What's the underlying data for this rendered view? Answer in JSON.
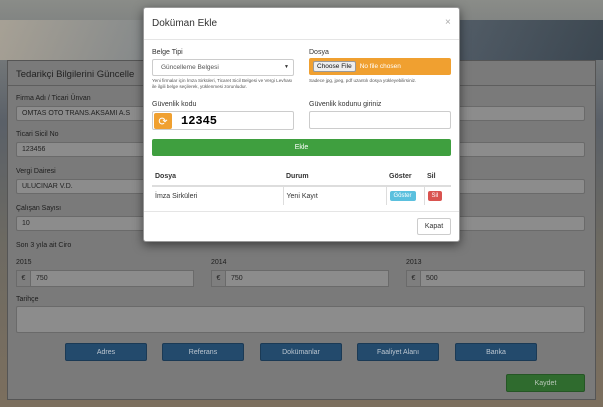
{
  "page": {
    "title": "Tedarikçi Bilgilerini Güncelle",
    "fields": {
      "company_label": "Firma Adı / Ticari Ünvan",
      "company_value": "OMTAS OTO TRANS.AKSAMI A.S",
      "trade_reg_label": "Ticari Sicil No",
      "trade_reg_value": "123456",
      "tax_office_label": "Vergi Dairesi",
      "tax_office_value": "ULUCINAR V.D.",
      "employees_label": "Çalışan Sayısı",
      "employees_value": "10",
      "revenue_label": "Son 3 yıla ait Ciro",
      "year1": "2015",
      "year1_value": "750",
      "year2": "2014",
      "year2_value": "750",
      "year3": "2013",
      "year3_value": "500",
      "currency_symbol": "€",
      "history_label": "Tarihçe"
    },
    "tabs": [
      "Adres",
      "Referans",
      "Dokümanlar",
      "Faaliyet Alanı",
      "Banka"
    ],
    "save_label": "Kaydet"
  },
  "modal": {
    "title": "Doküman Ekle",
    "close_glyph": "×",
    "doc_type_label": "Belge Tipi",
    "doc_type_value": "Güncelleme Belgesi",
    "doc_type_help": "Yeni firmalar için İmza Sirküleri, Ticaret Sicil Belgesi ve Vergi Levhası ile ilgili belge seçilerek, yüklenmesi zorunludur.",
    "file_label": "Dosya",
    "file_button": "Choose File",
    "file_status": "No file chosen",
    "file_help": "Sadece jpg, jpeg, pdf uzantılı dosya yükleyebilirsiniz.",
    "security_label": "Güvenlik kodu",
    "security_code": "12345",
    "security_input_label": "Güvenlik kodunu giriniz",
    "add_label": "Ekle",
    "table": {
      "headers": [
        "Dosya",
        "Durum",
        "Göster",
        "Sil"
      ],
      "rows": [
        {
          "file": "İmza Sirküleri",
          "status": "Yeni Kayıt",
          "show": "Göster",
          "delete": "Sil"
        }
      ]
    },
    "close_label": "Kapat"
  },
  "colors": {
    "accent_orange": "#f0a030",
    "add_green": "#3f9f3f",
    "show_blue": "#5bc0de",
    "delete_red": "#d9534f",
    "tab_navy": "#234a6c"
  }
}
